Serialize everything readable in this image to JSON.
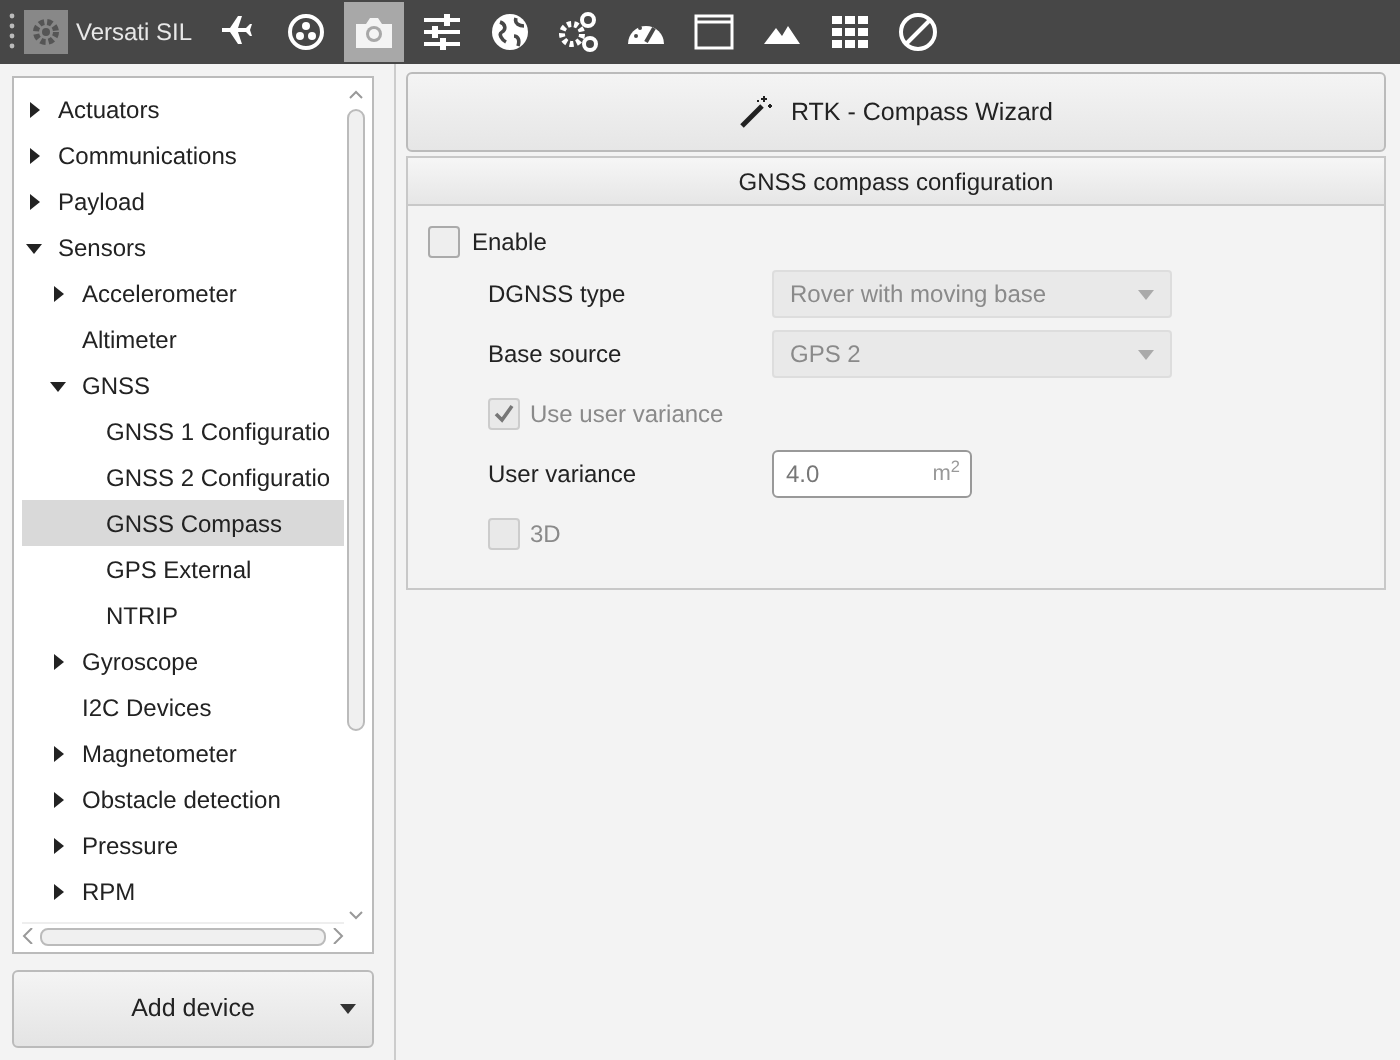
{
  "toolbar": {
    "app": {
      "title": "Versati SIL"
    },
    "tools": [
      {
        "kind": "plane",
        "selected": false
      },
      {
        "kind": "dots",
        "selected": false
      },
      {
        "kind": "camera",
        "selected": true
      },
      {
        "kind": "sliders",
        "selected": false
      },
      {
        "kind": "globe",
        "selected": false
      },
      {
        "kind": "gears",
        "selected": false
      },
      {
        "kind": "gauge",
        "selected": false
      },
      {
        "kind": "window",
        "selected": false
      },
      {
        "kind": "mountains",
        "selected": false
      },
      {
        "kind": "grid",
        "selected": false
      },
      {
        "kind": "forbidden",
        "selected": false
      }
    ]
  },
  "sidebar": {
    "tree": [
      {
        "label": "Actuators",
        "expanded": false,
        "selected": false
      },
      {
        "label": "Communications",
        "expanded": false,
        "selected": false
      },
      {
        "label": "Payload",
        "expanded": false,
        "selected": false
      },
      {
        "label": "Sensors",
        "expanded": true,
        "selected": false,
        "children": [
          {
            "label": "Accelerometer",
            "expanded": false,
            "selected": false
          },
          {
            "label": "Altimeter",
            "selected": false
          },
          {
            "label": "GNSS",
            "expanded": true,
            "selected": false,
            "children": [
              {
                "label": "GNSS 1 Configuratio",
                "selected": false
              },
              {
                "label": "GNSS 2 Configuratio",
                "selected": false
              },
              {
                "label": "GNSS Compass",
                "selected": true
              },
              {
                "label": "GPS External",
                "selected": false
              },
              {
                "label": "NTRIP",
                "selected": false
              }
            ]
          },
          {
            "label": "Gyroscope",
            "expanded": false,
            "selected": false
          },
          {
            "label": "I2C Devices",
            "selected": false
          },
          {
            "label": "Magnetometer",
            "expanded": false,
            "selected": false
          },
          {
            "label": "Obstacle detection",
            "expanded": false,
            "selected": false
          },
          {
            "label": "Pressure",
            "expanded": false,
            "selected": false
          },
          {
            "label": "RPM",
            "expanded": false,
            "selected": false
          }
        ]
      }
    ],
    "add_button": "Add device"
  },
  "wizard_button": "RTK - Compass Wizard",
  "panel": {
    "title": "GNSS compass configuration",
    "enable": {
      "label": "Enable",
      "checked": false
    },
    "rows": [
      {
        "kind": "select",
        "label": "DGNSS type",
        "value": "Rover with moving base",
        "disabled": true
      },
      {
        "kind": "select",
        "label": "Base source",
        "value": "GPS 2",
        "disabled": true
      },
      {
        "kind": "checkbox",
        "label": "Use user variance",
        "checked": true,
        "disabled": true
      },
      {
        "kind": "input",
        "label": "User variance",
        "value": "4.0",
        "unit": "m$^{2}$"
      },
      {
        "kind": "checkbox",
        "label": "3D",
        "checked": false,
        "disabled": true
      }
    ]
  }
}
